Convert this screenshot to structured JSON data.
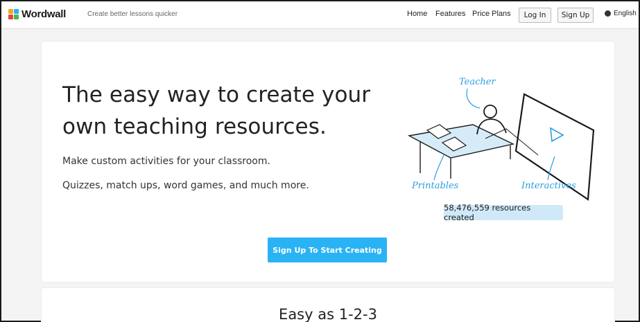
{
  "brand": {
    "name": "Wordwall",
    "tagline": "Create better lessons quicker",
    "logo_colors": [
      "#f6a623",
      "#2ab3f4",
      "#e8463c",
      "#4db848"
    ]
  },
  "nav": {
    "home": "Home",
    "features": "Features",
    "price_plans": "Price Plans",
    "login": "Log In",
    "signup": "Sign Up",
    "language": "English"
  },
  "hero": {
    "title": "The easy way to create your own teaching resources.",
    "subtitle_1": "Make custom activities for your classroom.",
    "subtitle_2": "Quizzes, match ups, word games, and much more.",
    "cta": "Sign Up To Start Creating",
    "counter": "58,476,559 resources created",
    "illustration": {
      "teacher": "Teacher",
      "printables": "Printables",
      "interactives": "Interactives"
    }
  },
  "section2": {
    "title": "Easy as 1-2-3"
  },
  "colors": {
    "accent": "#2ab3f4",
    "counter_bg": "#cfe9f8",
    "sketch_blue": "#2a9ee0"
  }
}
